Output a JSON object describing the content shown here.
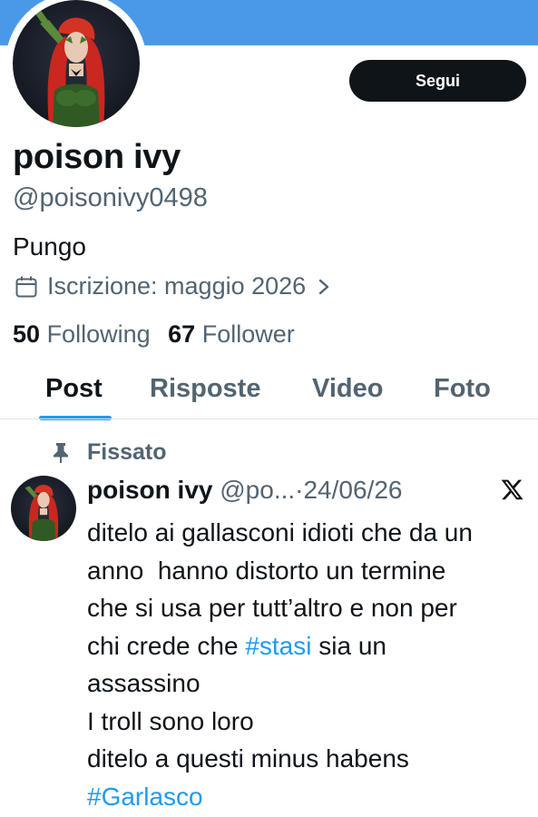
{
  "profile": {
    "name": "poison ivy",
    "handle": "@poisonivy0498",
    "bio": "Pungo",
    "joined": "Iscrizione: maggio 2026",
    "follow_label": "Segui"
  },
  "stats": {
    "following_count": "50",
    "following_label": "Following",
    "followers_count": "67",
    "followers_label": "Follower"
  },
  "tabs": [
    {
      "label": "Post",
      "active": true
    },
    {
      "label": "Risposte",
      "active": false
    },
    {
      "label": "Video",
      "active": false
    },
    {
      "label": "Foto",
      "active": false
    }
  ],
  "pinned_post": {
    "pinned_label": "Fissato",
    "author_name": "poison ivy",
    "author_handle": "@po...",
    "separator": "·",
    "date": "24/06/26",
    "lines": {
      "l1": "ditelo ai gallasconi idioti che da un",
      "l2": "anno  hanno distorto un termine",
      "l3": "che si usa per tutt’altro e non per",
      "l4_pre": "chi crede che ",
      "l4_tag": "#stasi",
      "l4_post": " sia un",
      "l5": "assassino",
      "l6": "I troll sono loro",
      "l7": "ditelo a questi minus habens",
      "l8_tag": "#Garlasco"
    }
  },
  "colors": {
    "banner": "#4a99e9",
    "accent": "#1d9bf0",
    "secondary_text": "#536471",
    "primary_text": "#0f1419"
  },
  "icons": [
    "calendar-icon",
    "chevron-right-icon",
    "pin-icon",
    "x-logo-icon"
  ]
}
